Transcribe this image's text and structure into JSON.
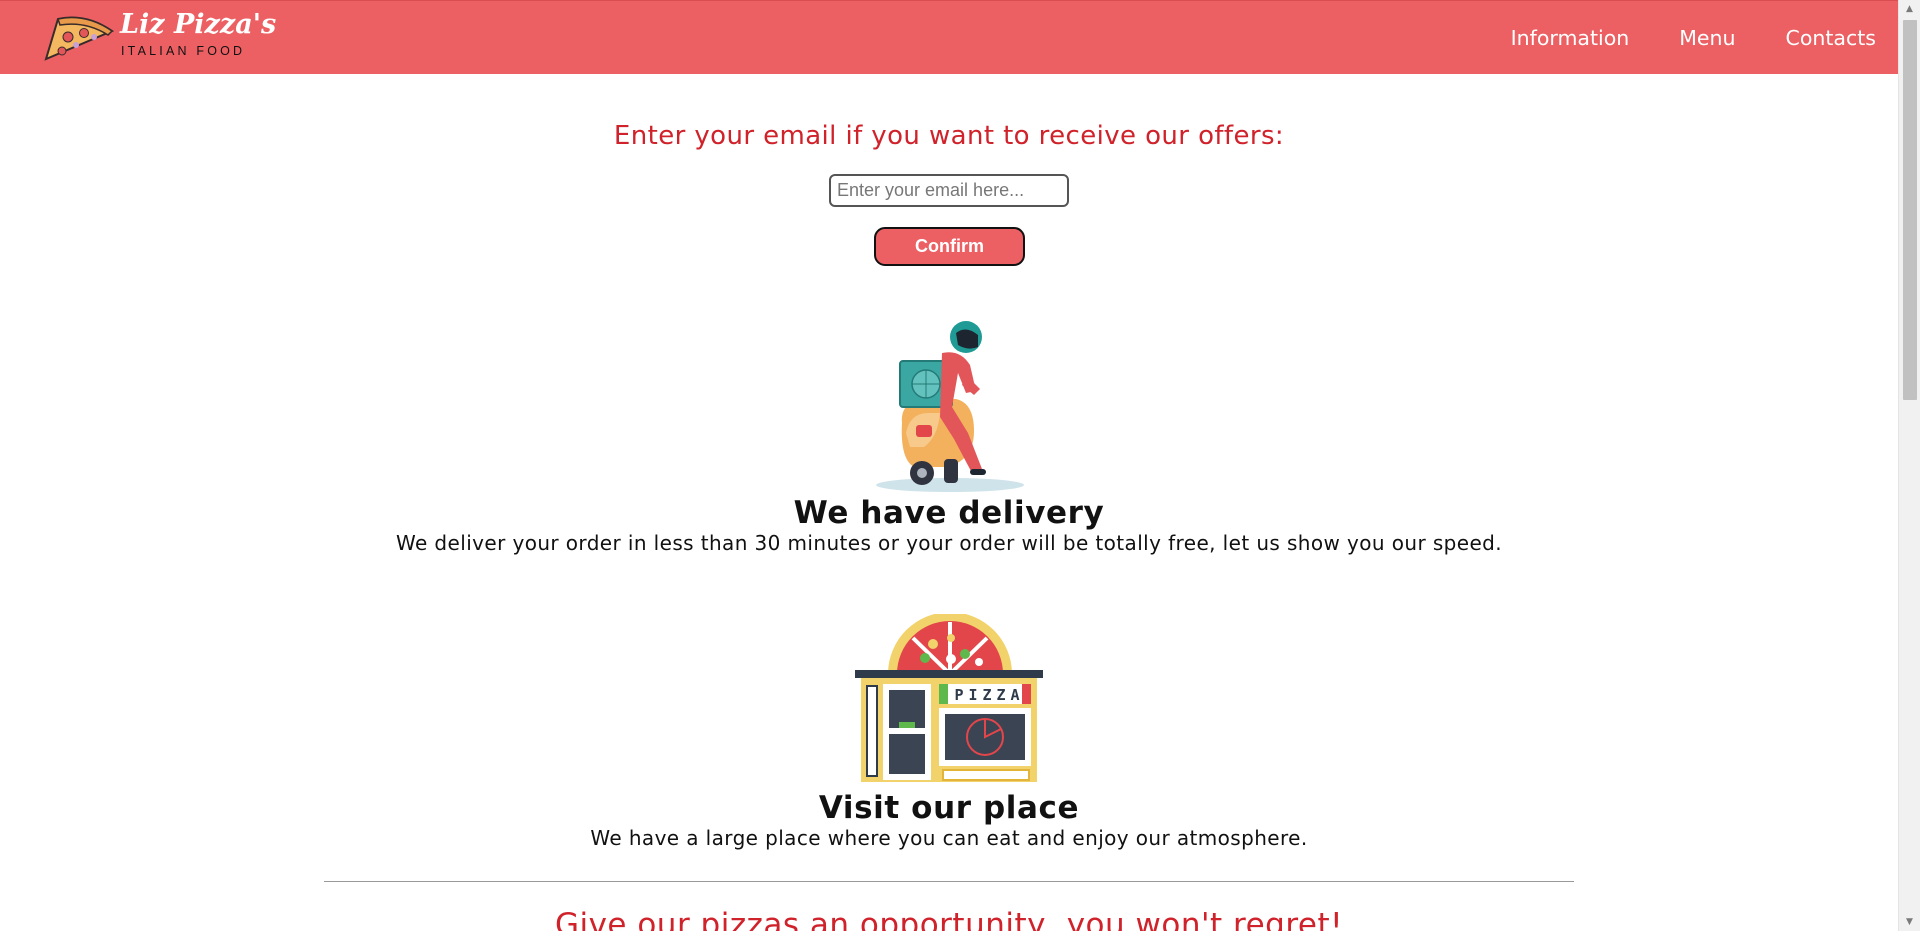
{
  "header": {
    "logo_title": "Liz Pizza's",
    "logo_subtitle": "ITALIAN FOOD",
    "nav": [
      "Information",
      "Menu",
      "Contacts"
    ]
  },
  "newsletter": {
    "title": "Enter your email if you want to receive our offers:",
    "email_placeholder": "Enter your email here...",
    "confirm_label": "Confirm"
  },
  "delivery": {
    "title": "We have delivery",
    "text": "We deliver your order in less than 30 minutes or your order will be totally free, let us show you our speed."
  },
  "place": {
    "title": "Visit our place",
    "text": "We have a large place where you can eat and enjoy our atmosphere.",
    "sign_letters": [
      "P",
      "I",
      "Z",
      "Z",
      "A"
    ]
  },
  "promo": {
    "title": "Give our pizzas an opportunity, you won't regret!"
  },
  "colors": {
    "brand": "#ec6064",
    "accent_text": "#d0222a"
  }
}
